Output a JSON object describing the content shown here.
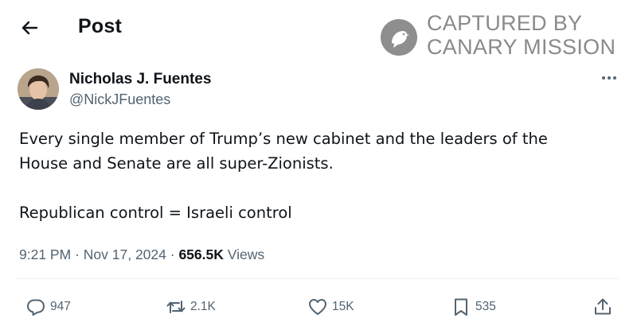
{
  "header": {
    "title": "Post",
    "back_icon": "arrow-left-icon"
  },
  "watermark": {
    "line1": "CAPTURED BY",
    "line2": "CANARY MISSION",
    "logo_icon": "canary-bird-icon",
    "color": "#8a8a8a"
  },
  "author": {
    "name": "Nicholas J. Fuentes",
    "handle": "@NickJFuentes"
  },
  "tweet": {
    "line1": "Every single member of Trump’s new cabinet and the leaders of the",
    "line2": "House and Senate are all super-Zionists.",
    "line3": "Republican control = Israeli control"
  },
  "meta": {
    "time": "9:21 PM",
    "separator": "·",
    "date": "Nov 17, 2024",
    "views_count": "656.5K",
    "views_label": "Views"
  },
  "actions": {
    "replies": "947",
    "reposts": "2.1K",
    "likes": "15K",
    "bookmarks": "535"
  },
  "colors": {
    "text": "#0f1419",
    "secondary": "#536471",
    "divider": "#eff3f4"
  }
}
